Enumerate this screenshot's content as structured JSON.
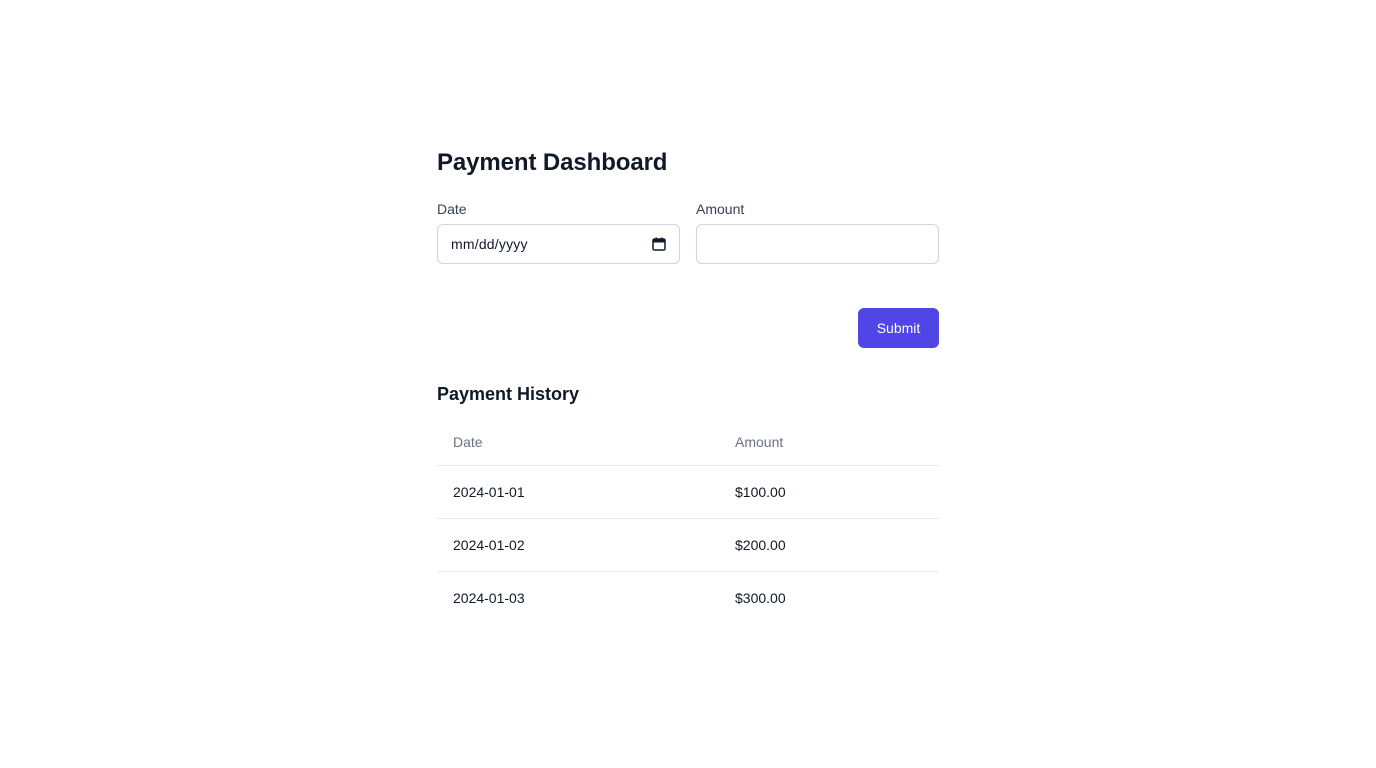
{
  "page": {
    "title": "Payment Dashboard"
  },
  "form": {
    "date_label": "Date",
    "date_placeholder": "mm/dd/yyyy",
    "amount_label": "Amount",
    "amount_value": "",
    "submit_label": "Submit"
  },
  "history": {
    "title": "Payment History",
    "columns": [
      "Date",
      "Amount"
    ],
    "rows": [
      {
        "date": "2024-01-01",
        "amount": "$100.00"
      },
      {
        "date": "2024-01-02",
        "amount": "$200.00"
      },
      {
        "date": "2024-01-03",
        "amount": "$300.00"
      }
    ]
  },
  "icons": {
    "date_picker": "calendar-icon"
  },
  "colors": {
    "accent": "#4f46e5",
    "text": "#111827",
    "muted": "#6b7280",
    "border": "#d1d5db"
  }
}
